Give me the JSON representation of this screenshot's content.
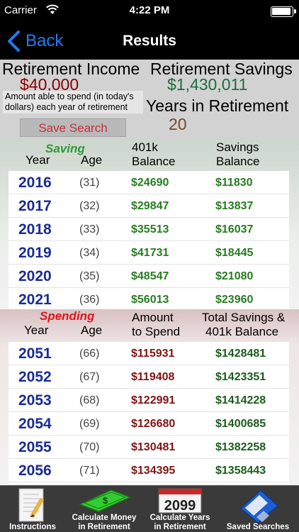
{
  "status": {
    "carrier": "Carrier",
    "time": "4:22 PM"
  },
  "nav": {
    "back_label": "Back",
    "title": "Results"
  },
  "summary": {
    "income_label": "Retirement Income",
    "income_value": "$40,000",
    "income_note": "Amount able to spend (in today's dollars) each year of retirement",
    "savings_label": "Retirement Savings",
    "savings_value": "$1,430,011",
    "years_label": "Years in Retirement",
    "years_value": "20",
    "save_search_label": "Save Search"
  },
  "saving": {
    "title": "Saving",
    "col_year": "Year",
    "col_age": "Age",
    "col_401k_1": "401k",
    "col_401k_2": "Balance",
    "col_savings_1": "Savings",
    "col_savings_2": "Balance",
    "rows": [
      {
        "year": "2016",
        "age": "(31)",
        "balance_401k": "$24690",
        "savings_balance": "$11830"
      },
      {
        "year": "2017",
        "age": "(32)",
        "balance_401k": "$29847",
        "savings_balance": "$13837"
      },
      {
        "year": "2018",
        "age": "(33)",
        "balance_401k": "$35513",
        "savings_balance": "$16037"
      },
      {
        "year": "2019",
        "age": "(34)",
        "balance_401k": "$41731",
        "savings_balance": "$18445"
      },
      {
        "year": "2020",
        "age": "(35)",
        "balance_401k": "$48547",
        "savings_balance": "$21080"
      },
      {
        "year": "2021",
        "age": "(36)",
        "balance_401k": "$56013",
        "savings_balance": "$23960"
      }
    ]
  },
  "spending": {
    "title": "Spending",
    "col_year": "Year",
    "col_age": "Age",
    "col_amount_1": "Amount",
    "col_amount_2": "to Spend",
    "col_total_1": "Total Savings &",
    "col_total_2": "401k Balance",
    "rows": [
      {
        "year": "2051",
        "age": "(66)",
        "amount": "$115931",
        "total": "$1428481"
      },
      {
        "year": "2052",
        "age": "(67)",
        "amount": "$119408",
        "total": "$1423351"
      },
      {
        "year": "2053",
        "age": "(68)",
        "amount": "$122991",
        "total": "$1414228"
      },
      {
        "year": "2054",
        "age": "(69)",
        "amount": "$126680",
        "total": "$1400685"
      },
      {
        "year": "2055",
        "age": "(70)",
        "amount": "$130481",
        "total": "$1382258"
      },
      {
        "year": "2056",
        "age": "(71)",
        "amount": "$134395",
        "total": "$1358443"
      }
    ]
  },
  "tabs": [
    {
      "label_1": "Instructions",
      "label_2": "",
      "icon": "notepad-icon"
    },
    {
      "label_1": "Calculate Money",
      "label_2": "in Retirement",
      "icon": "money-icon"
    },
    {
      "label_1": "Calculate Years",
      "label_2": "in Retirement",
      "icon": "calendar-icon"
    },
    {
      "label_1": "Saved Searches",
      "label_2": "",
      "icon": "floppy-disk-icon"
    }
  ],
  "calendar_icon_text": "2099",
  "colors": {
    "accent": "#1f7cf5",
    "income": "#8b0000",
    "savings": "#1e6e3c",
    "saving_title": "#2e9a35",
    "spending_title": "#e0141b"
  }
}
